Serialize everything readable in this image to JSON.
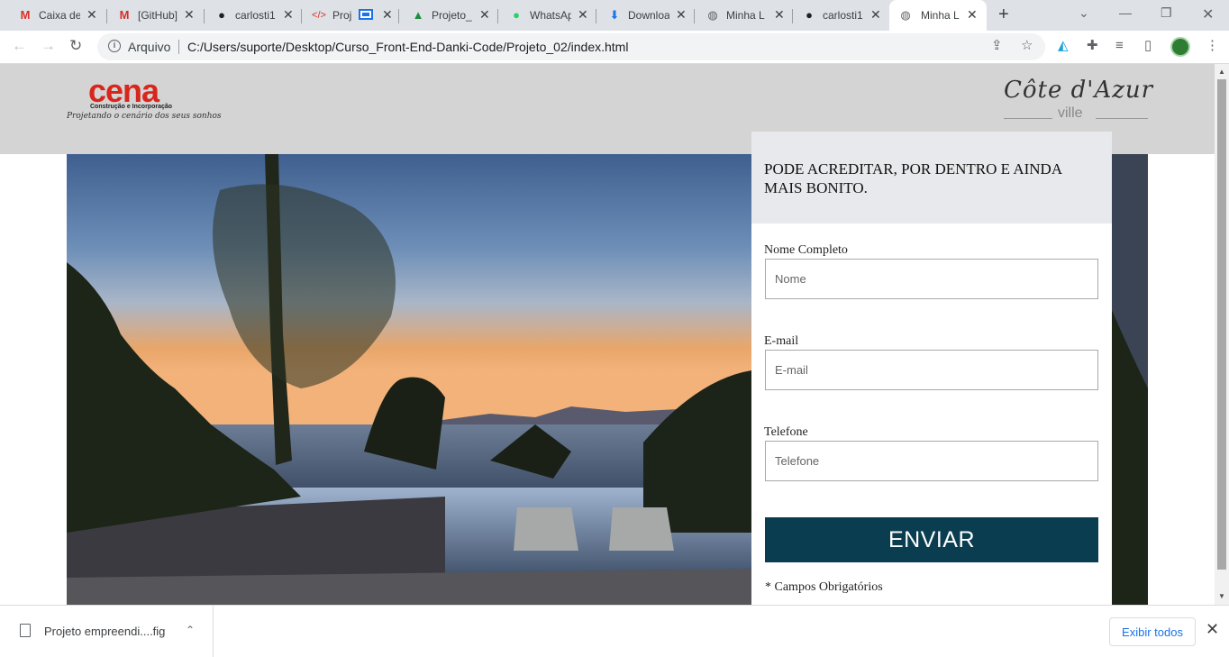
{
  "browser": {
    "tabs": [
      {
        "icon": "gmail-icon",
        "glyph": "M",
        "color": "#d93025",
        "label": "Caixa de"
      },
      {
        "icon": "gmail-icon",
        "glyph": "M",
        "color": "#d93025",
        "label": "[GitHub]"
      },
      {
        "icon": "github-icon",
        "glyph": "●",
        "color": "#202124",
        "label": "carlosti1"
      },
      {
        "icon": "code-icon",
        "glyph": "</>",
        "color": "#d93025",
        "label": "Proj"
      },
      {
        "icon": "drive-icon",
        "glyph": "▲",
        "color": "#1e8e3e",
        "label": "Projeto_"
      },
      {
        "icon": "whatsapp-icon",
        "glyph": "●",
        "color": "#25d366",
        "label": "WhatsAp"
      },
      {
        "icon": "download-icon",
        "glyph": "⬇",
        "color": "#1a73e8",
        "label": "Downloa"
      },
      {
        "icon": "globe-icon",
        "glyph": "◍",
        "color": "#5f6368",
        "label": "Minha L"
      },
      {
        "icon": "github-icon",
        "glyph": "●",
        "color": "#202124",
        "label": "carlosti1"
      },
      {
        "icon": "globe-icon",
        "glyph": "◍",
        "color": "#5f6368",
        "label": "Minha L"
      }
    ],
    "address": {
      "scheme_label": "Arquivo",
      "url": "C:/Users/suporte/Desktop/Curso_Front-End-Danki-Code/Projeto_02/index.html"
    }
  },
  "header": {
    "brand_left": {
      "name": "cena",
      "tagline": "Construção e Incorporação",
      "slogan": "Projetando o cenário dos seus sonhos"
    },
    "brand_right": {
      "name": "Côte d'Azur",
      "sub": "ville"
    }
  },
  "form": {
    "title": "PODE ACREDITAR, POR DENTRO E AINDA MAIS BONITO.",
    "fields": [
      {
        "label": "Nome Completo",
        "placeholder": "Nome"
      },
      {
        "label": "E-mail",
        "placeholder": "E-mail"
      },
      {
        "label": "Telefone",
        "placeholder": "Telefone"
      }
    ],
    "submit_label": "ENVIAR",
    "note": "* Campos Obrigatórios"
  },
  "downloads": {
    "file_name": "Projeto empreendi....fig",
    "show_all_label": "Exibir todos"
  },
  "colors": {
    "form_button": "#0b3d50",
    "header_bg": "#d4d4d4",
    "brand_red": "#d8261c"
  }
}
